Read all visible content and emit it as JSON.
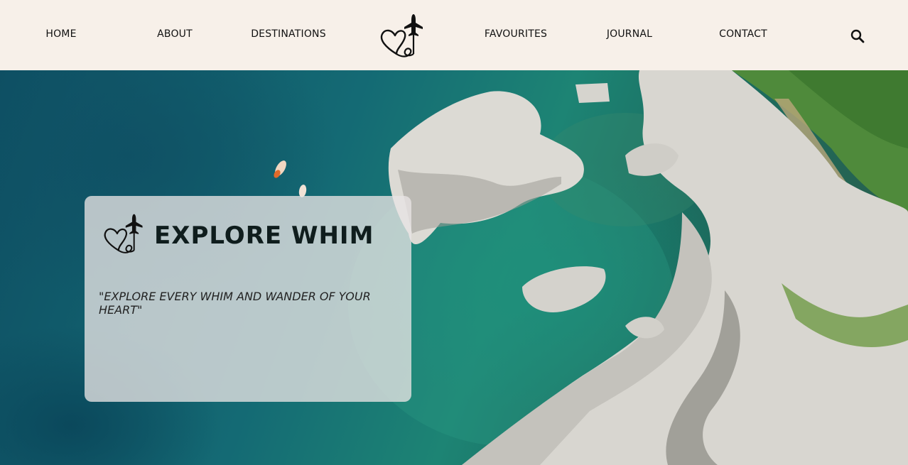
{
  "nav": {
    "home": "HOME",
    "about": "ABOUT",
    "destinations": "DESTINATIONS",
    "favourites": "FAVOURITES",
    "journal": "JOURNAL",
    "contact": "CONTACT",
    "search_icon": "search-icon",
    "logo_icon": "heart-airplane-logo"
  },
  "hero": {
    "title": "EXPLORE WHIM",
    "tagline": "\"EXPLORE EVERY WHIM AND WANDER OF YOUR HEART\""
  },
  "colors": {
    "nav_background": "#f7f0e9",
    "text": "#111111",
    "card_background": "rgba(232,228,228,0.78)"
  }
}
